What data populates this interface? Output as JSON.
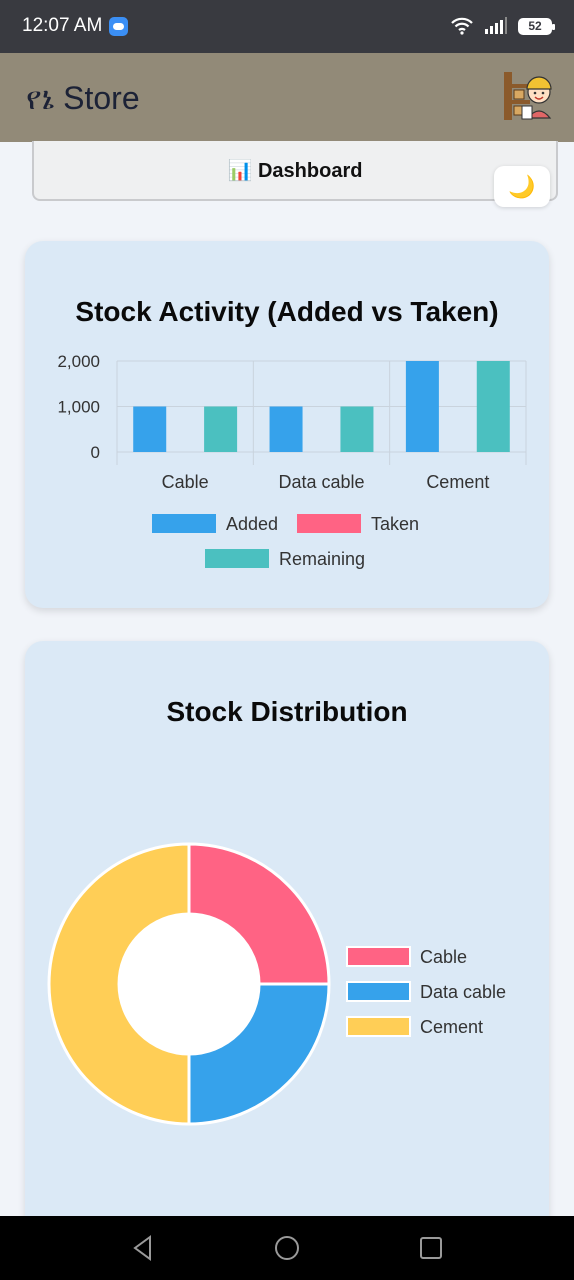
{
  "status_bar": {
    "time": "12:07 AM",
    "battery": "52"
  },
  "app_bar": {
    "title": "የኔ Store"
  },
  "dashboard_tab": {
    "label": "📊 Dashboard"
  },
  "theme_toggle": {
    "icon": "🌙"
  },
  "activity_chart": {
    "title": "Stock Activity (Added vs Taken)",
    "chart_data": {
      "type": "bar",
      "categories": [
        "Cable",
        "Data cable",
        "Cement"
      ],
      "series": [
        {
          "name": "Added",
          "values": [
            1000,
            1000,
            2000
          ],
          "color": "#36a2eb"
        },
        {
          "name": "Taken",
          "values": [
            0,
            0,
            0
          ],
          "color": "#ff6384"
        },
        {
          "name": "Remaining",
          "values": [
            1000,
            1000,
            2000
          ],
          "color": "#4bc0c0"
        }
      ],
      "yticks": [
        "2,000",
        "1,000",
        "0"
      ],
      "ylim": [
        0,
        2000
      ],
      "grid": true,
      "legend": "bottom"
    }
  },
  "distribution_chart": {
    "title": "Stock Distribution",
    "chart_data": {
      "type": "pie",
      "variant": "doughnut",
      "labels": [
        "Cable",
        "Data cable",
        "Cement"
      ],
      "values": [
        1000,
        1000,
        2000
      ],
      "colors": [
        "#ff6384",
        "#36a2eb",
        "#ffce56"
      ],
      "legend": "right"
    }
  },
  "nav": {
    "icons": [
      "back-icon",
      "home-icon",
      "recents-icon"
    ]
  }
}
